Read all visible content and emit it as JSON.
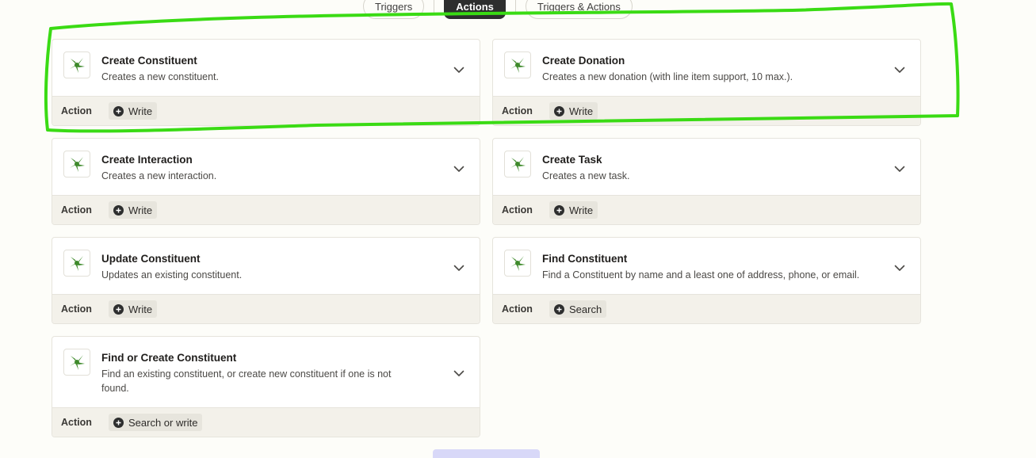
{
  "tabs": [
    {
      "label": "Triggers",
      "active": false
    },
    {
      "label": "Actions",
      "active": true
    },
    {
      "label": "Triggers & Actions",
      "active": false
    }
  ],
  "cards": [
    {
      "title": "Create Constituent",
      "desc": "Creates a new constituent.",
      "kind": "Action",
      "op": "Write"
    },
    {
      "title": "Create Donation",
      "desc": "Creates a new donation (with line item support, 10 max.).",
      "kind": "Action",
      "op": "Write"
    },
    {
      "title": "Create Interaction",
      "desc": "Creates a new interaction.",
      "kind": "Action",
      "op": "Write"
    },
    {
      "title": "Create Task",
      "desc": "Creates a new task.",
      "kind": "Action",
      "op": "Write"
    },
    {
      "title": "Update Constituent",
      "desc": "Updates an existing constituent.",
      "kind": "Action",
      "op": "Write"
    },
    {
      "title": "Find Constituent",
      "desc": "Find a Constituent by name and a least one of address, phone, or email.",
      "kind": "Action",
      "op": "Search"
    },
    {
      "title": "Find or Create Constituent",
      "desc": "Find an existing constituent, or create new constituent if one is not found.",
      "kind": "Action",
      "op": "Search or write"
    }
  ],
  "colors": {
    "annotation": "#3adb14",
    "logo_green": "#3e8a2b",
    "button": "#d8d8f8"
  }
}
